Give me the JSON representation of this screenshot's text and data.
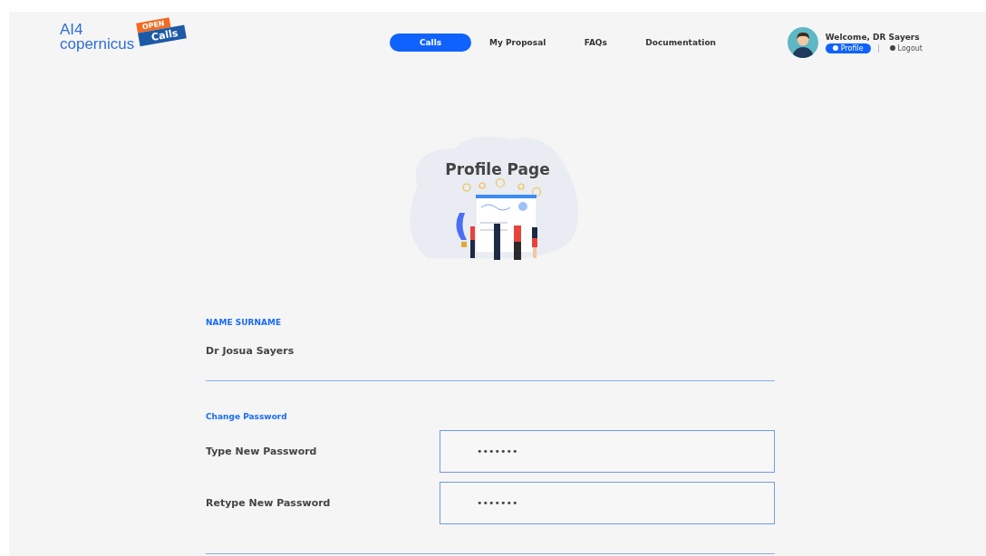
{
  "logo": {
    "line1": "AI4",
    "line2": "copernicus",
    "ribbon_top": "OPEN",
    "ribbon_bottom": "Calls"
  },
  "nav": [
    {
      "label": "Calls",
      "selected": true
    },
    {
      "label": "My Proposal",
      "selected": false
    },
    {
      "label": "FAQs",
      "selected": false
    },
    {
      "label": "Documentation",
      "selected": false
    }
  ],
  "user": {
    "welcome": "Welcome, DR Sayers",
    "profile_button": "Profile",
    "logout": "Logout"
  },
  "page_title": "Profile Page",
  "name_section": {
    "label": "NAME SURNAME",
    "value": "Dr Josua Sayers"
  },
  "password_section": {
    "label": "Change Password",
    "fields": [
      {
        "label": "Type New Password",
        "value": "•••••••"
      },
      {
        "label": "Retype New Password",
        "value": "•••••••"
      }
    ]
  }
}
